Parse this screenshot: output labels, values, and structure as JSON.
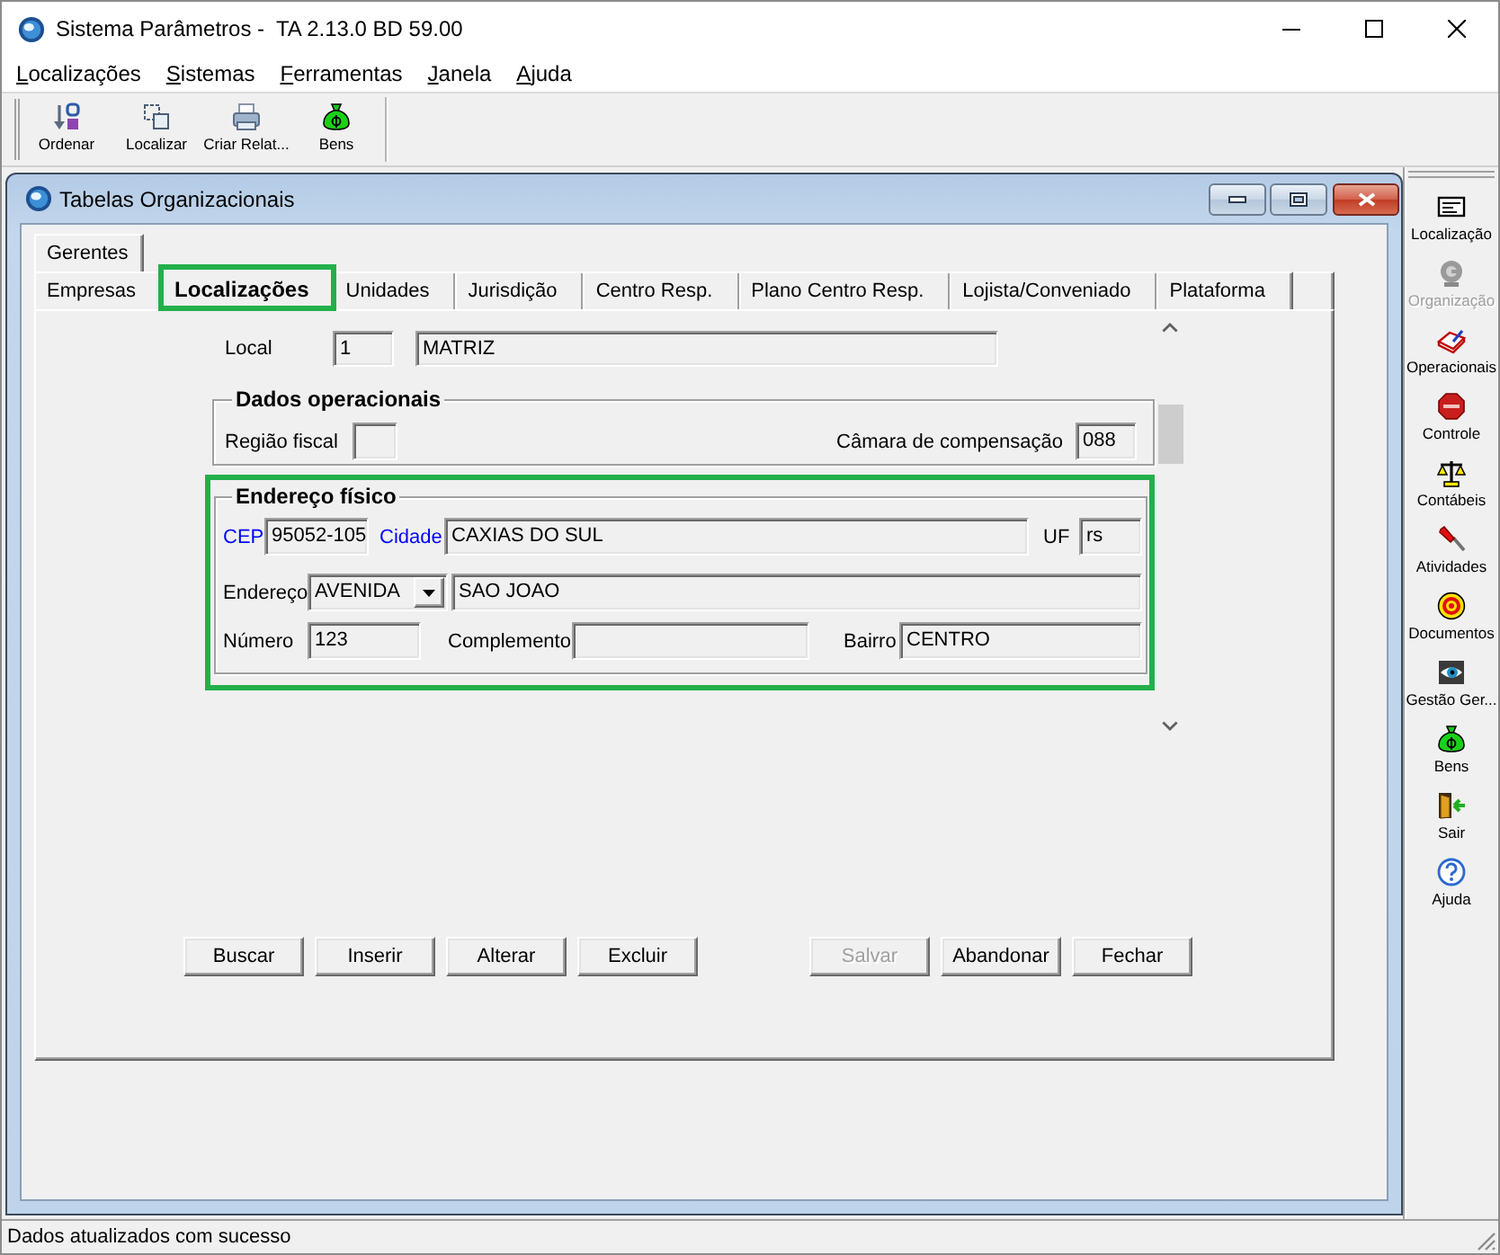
{
  "window": {
    "title": "Sistema Parâmetros -  TA 2.13.0 BD 59.00"
  },
  "menu": [
    {
      "label": "Localizações"
    },
    {
      "label": "Sistemas"
    },
    {
      "label": "Ferramentas"
    },
    {
      "label": "Janela"
    },
    {
      "label": "Ajuda"
    }
  ],
  "toolbar": [
    {
      "label": "Ordenar",
      "kind": "sort"
    },
    {
      "label": "Localizar",
      "kind": "find"
    },
    {
      "label": "Criar Relat...",
      "kind": "print"
    },
    {
      "label": "Bens",
      "kind": "money"
    }
  ],
  "child_window": {
    "title": "Tabelas Organizacionais"
  },
  "tab_rows": [
    [
      {
        "label": "Gerentes",
        "selected": false,
        "highlighted": false
      }
    ],
    [
      {
        "label": "Empresas",
        "selected": false,
        "highlighted": false
      },
      {
        "label": "Localizações",
        "selected": true,
        "highlighted": true
      },
      {
        "label": "Unidades",
        "selected": false,
        "highlighted": false
      },
      {
        "label": "Jurisdição",
        "selected": false,
        "highlighted": false
      },
      {
        "label": "Centro Resp.",
        "selected": false,
        "highlighted": false
      },
      {
        "label": "Plano Centro Resp.",
        "selected": false,
        "highlighted": false
      },
      {
        "label": "Lojista/Conveniado",
        "selected": false,
        "highlighted": false
      },
      {
        "label": "Plataforma",
        "selected": false,
        "highlighted": false
      }
    ]
  ],
  "form": {
    "local": {
      "label": "Local",
      "code": "1",
      "name": "MATRIZ"
    },
    "operational": {
      "title": "Dados operacionais",
      "fiscal_region": {
        "label": "Região fiscal"
      },
      "clearing_house": {
        "label": "Câmara de compensação",
        "value": "088"
      }
    },
    "address": {
      "title": "Endereço físico",
      "highlighted": true,
      "cep": {
        "label": "CEP",
        "link": true,
        "value": "95052-105"
      },
      "city": {
        "label": "Cidade",
        "link": true,
        "value": "CAXIAS DO SUL"
      },
      "uf": {
        "label": "UF",
        "link": false,
        "value": "rs"
      },
      "street_type": {
        "label": "Endereço",
        "link": false,
        "value": "AVENIDA"
      },
      "street": {
        "value": "SAO JOAO"
      },
      "number": {
        "label": "Número",
        "link": false,
        "value": "123"
      },
      "complement": {
        "label": "Complemento",
        "link": false
      },
      "district": {
        "label": "Bairro",
        "link": false,
        "value": "CENTRO"
      }
    }
  },
  "record_buttons": [
    {
      "label": "Buscar",
      "disabled": false
    },
    {
      "label": "Inserir",
      "disabled": false
    },
    {
      "label": "Alterar",
      "disabled": false
    },
    {
      "label": "Excluir",
      "disabled": false
    }
  ],
  "edit_buttons": [
    {
      "label": "Salvar",
      "disabled": true
    },
    {
      "label": "Abandonar",
      "disabled": false
    },
    {
      "label": "Fechar",
      "disabled": false
    }
  ],
  "sidebar": [
    {
      "label": "Localização",
      "kind": "card",
      "disabled": false
    },
    {
      "label": "Organização",
      "kind": "globe",
      "disabled": true
    },
    {
      "label": "Operacionais",
      "kind": "book",
      "disabled": false
    },
    {
      "label": "Controle",
      "kind": "stop",
      "disabled": false
    },
    {
      "label": "Contábeis",
      "kind": "scales",
      "disabled": false
    },
    {
      "label": "Atividades",
      "kind": "screwdriver",
      "disabled": false
    },
    {
      "label": "Documentos",
      "kind": "target",
      "disabled": false
    },
    {
      "label": "Gestão Ger...",
      "kind": "eye",
      "disabled": false
    },
    {
      "label": "Bens",
      "kind": "money",
      "disabled": false
    },
    {
      "label": "Sair",
      "kind": "exit",
      "disabled": false
    },
    {
      "label": "Ajuda",
      "kind": "help",
      "disabled": false
    }
  ],
  "status_bar": {
    "message": "Dados atualizados com sucesso"
  }
}
